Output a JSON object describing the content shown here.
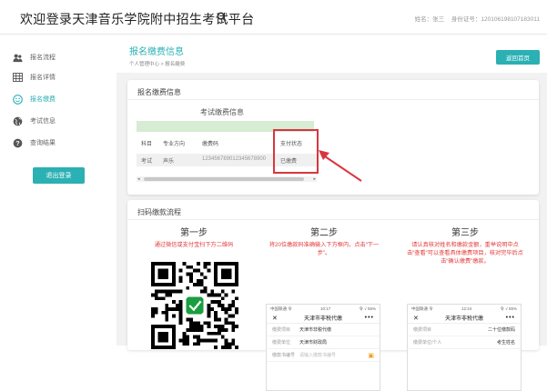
{
  "header": {
    "title": "欢迎登录天津音乐学院附中招生考试平台",
    "user_name": "姓名：张三",
    "user_id": "身份证号：120106198107183011"
  },
  "sidebar": {
    "items": [
      {
        "label": "报名流程",
        "icon": "users-icon"
      },
      {
        "label": "报名详情",
        "icon": "table-icon"
      },
      {
        "label": "报名缴费",
        "icon": "smile-icon"
      },
      {
        "label": "考试信息",
        "icon": "globe-icon"
      },
      {
        "label": "查询结果",
        "icon": "question-icon"
      }
    ],
    "active_index": 2,
    "logout_label": "退出登录"
  },
  "page": {
    "title": "报名缴费信息",
    "breadcrumb": "个人管理中心 > 报名缴费",
    "back_label": "返回首页"
  },
  "fee_card": {
    "title": "报名缴费信息",
    "caption": "考试缴费信息",
    "headers": [
      "科目",
      "专业方向",
      "缴费码",
      "支付状态"
    ],
    "row": [
      "考试",
      "声乐",
      "123456789012345678900",
      "已缴费"
    ]
  },
  "flow_card": {
    "title": "扫码缴款流程",
    "steps": [
      {
        "title": "第一步",
        "desc": "通过微信或支付宝扫下方二维码"
      },
      {
        "title": "第二步",
        "desc": "将20位缴款码准确输入下方框内，点击“下一步”。"
      },
      {
        "title": "第三步",
        "desc": "请认真核对姓名和缴款金额，重举说明中点击“查看”可以查看具体缴费项目，核对完毕后点击“确认缴费”缴款。"
      }
    ],
    "phone2": {
      "carrier": "中国联通 令",
      "time": "10:17",
      "battery": "令 √ 55%",
      "title": "天津市非税代缴",
      "rows": [
        {
          "k": "缴费项目",
          "v": "天津市非税代缴"
        },
        {
          "k": "缴费单位",
          "v": "天津市财政局"
        },
        {
          "k": "缴款书编号",
          "v": "请输入缴款书编号"
        }
      ]
    },
    "phone3": {
      "carrier": "中国联通 令",
      "time": "12:24",
      "battery": "令 √ 55%",
      "title": "天津市非税代缴",
      "rows": [
        {
          "k": "缴费项目",
          "v": "二十位缴款码"
        },
        {
          "k": "缴费单位/个人",
          "v": "考生姓名"
        }
      ]
    }
  },
  "colors": {
    "accent": "#2bb0b3",
    "highlight": "#d9363e",
    "step_text": "#e23a3a"
  }
}
